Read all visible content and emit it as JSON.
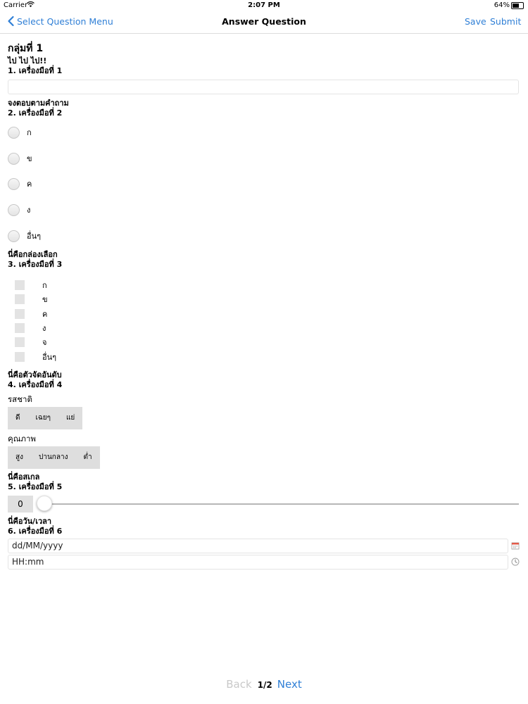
{
  "status_bar": {
    "carrier": "Carrier",
    "time": "2:07 PM",
    "battery": "64%",
    "battery_level": 0.64
  },
  "nav": {
    "back_label": "Select Question Menu",
    "title": "Answer Question",
    "save_label": "Save",
    "submit_label": "Submit"
  },
  "form": {
    "group_title": "กลุ่มที่ 1",
    "q1": {
      "description": "ไป ไป ไป!!",
      "label": "1. เครื่องมือที่ 1",
      "value": ""
    },
    "q2": {
      "description": "จงตอบตามคำถาม",
      "label": "2. เครื่องมือที่ 2",
      "options": [
        "ก",
        "ข",
        "ค",
        "ง",
        "อื่นๆ"
      ]
    },
    "q3": {
      "description": "นี่คือกล่องเลือก",
      "label": "3. เครื่องมือที่ 3",
      "options": [
        "ก",
        "ข",
        "ค",
        "ง",
        "จ",
        "อื่นๆ"
      ]
    },
    "q4": {
      "description": "นี่คือตัวจัดอันดับ",
      "label": "4. เครื่องมือที่ 4",
      "rankings": [
        {
          "title": "รสชาติ",
          "options": [
            "ดี",
            "เฉยๆ",
            "แย่"
          ]
        },
        {
          "title": "คุณภาพ",
          "options": [
            "สูง",
            "ปานกลาง",
            "ต่ำ"
          ]
        }
      ]
    },
    "q5": {
      "description": "นี่คือสเกล",
      "label": "5. เครื่องมือที่ 5",
      "value": "0"
    },
    "q6": {
      "description": "นี่คือวัน/เวลา",
      "label": "6. เครื่องมือที่ 6",
      "date_placeholder": "dd/MM/yyyy",
      "time_placeholder": "HH:mm"
    }
  },
  "pager": {
    "back_label": "Back",
    "page": "1/2",
    "next_label": "Next"
  },
  "colors": {
    "accent": "#2f7fd6",
    "disabled": "#c9c9c9"
  },
  "icons": {
    "back": "chevron-left-icon",
    "wifi": "wifi-icon",
    "battery": "battery-icon",
    "calendar": "calendar-icon",
    "clock": "clock-icon"
  }
}
